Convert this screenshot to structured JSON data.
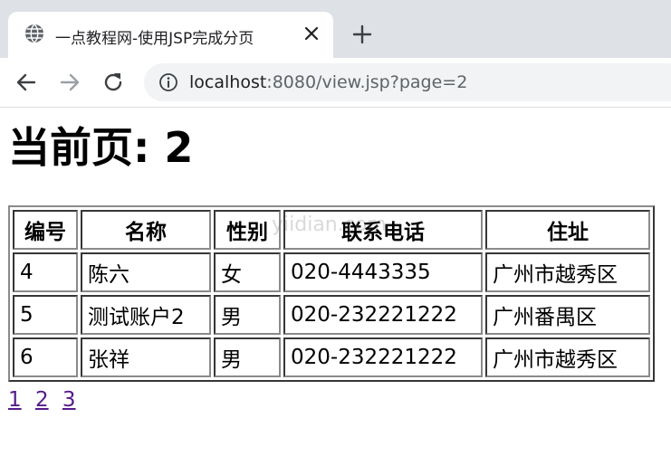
{
  "browser": {
    "tab": {
      "title": "一点教程网-使用JSP完成分页",
      "favicon": "globe-icon",
      "close_icon": "close-icon"
    },
    "new_tab_icon": "plus-icon",
    "toolbar": {
      "back_icon": "arrow-left-icon",
      "forward_icon": "arrow-right-icon",
      "reload_icon": "reload-icon",
      "info_icon": "info-icon"
    },
    "url": {
      "host": "localhost",
      "rest": ":8080/view.jsp?page=2"
    }
  },
  "page": {
    "heading": "当前页: 2",
    "table": {
      "headers": [
        "编号",
        "名称",
        "性别",
        "联系电话",
        "住址"
      ],
      "rows": [
        [
          "4",
          "陈六",
          "女",
          "020-4443335",
          "广州市越秀区"
        ],
        [
          "5",
          "测试账户2",
          "男",
          "020-232221222",
          "广州番禺区"
        ],
        [
          "6",
          "张祥",
          "男",
          "020-232221222",
          "广州市越秀区"
        ]
      ]
    },
    "pagination": [
      "1",
      "2",
      "3"
    ],
    "watermark": "yiidian.com"
  },
  "colors": {
    "tabstrip_bg": "#dee1e6",
    "omnibox_bg": "#f1f3f4",
    "link_visited": "#551a8b",
    "table_border": "#8a8a8a"
  }
}
